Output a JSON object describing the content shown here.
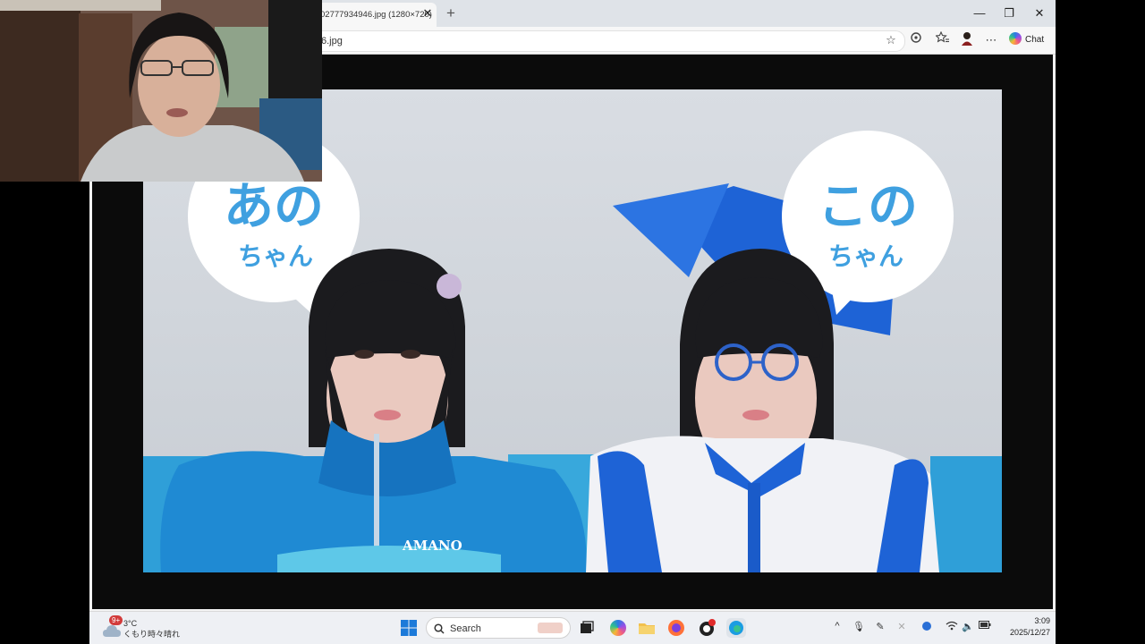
{
  "browser": {
    "tab_title": "02777934946.jpg (1280×720)",
    "tab_close": "✕",
    "new_tab": "+",
    "minimize": "—",
    "maximize": "❐",
    "close": "✕",
    "url": "6.jpg",
    "chat_label": "Chat"
  },
  "image": {
    "bubble_left_line1": "あの",
    "bubble_left_line2": "ちゃん",
    "bubble_right_line1": "この",
    "bubble_right_line2": "ちゃん",
    "jacket_text": "AMANO"
  },
  "taskbar": {
    "weather_badge": "9+",
    "weather_temp": "3°C",
    "weather_desc": "くもり時々晴れ",
    "search_placeholder": "Search",
    "time": "3:09",
    "date": "2025/12/27"
  },
  "colors": {
    "accent_blue": "#2f8fd8",
    "bubble_text_blue": "#3fa0e0",
    "jacket_blue": "#1f8ad3",
    "ribbon_blue": "#1e63d6"
  }
}
